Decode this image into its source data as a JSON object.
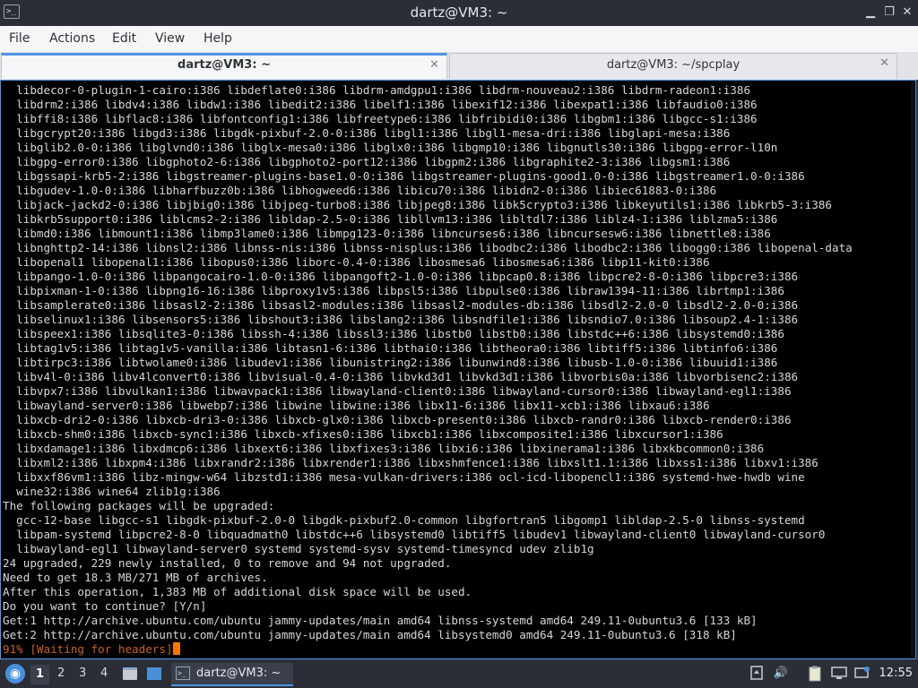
{
  "window": {
    "title": "dartz@VM3: ~",
    "app_icon_glyph": ">_",
    "controls": {
      "minimize": "▁",
      "maximize": "❐",
      "close": "✕"
    }
  },
  "menubar": {
    "items": [
      "File",
      "Actions",
      "Edit",
      "View",
      "Help"
    ]
  },
  "tabs": [
    {
      "label": "dartz@VM3: ~",
      "active": true,
      "close": "✕"
    },
    {
      "label": "dartz@VM3: ~/spcplay",
      "active": false,
      "close": "✕"
    }
  ],
  "terminal": {
    "lines": [
      "  libdecor-0-plugin-1-cairo:i386 libdeflate0:i386 libdrm-amdgpu1:i386 libdrm-nouveau2:i386 libdrm-radeon1:i386",
      "  libdrm2:i386 libdv4:i386 libdw1:i386 libedit2:i386 libelf1:i386 libexif12:i386 libexpat1:i386 libfaudio0:i386",
      "  libffi8:i386 libflac8:i386 libfontconfig1:i386 libfreetype6:i386 libfribidi0:i386 libgbm1:i386 libgcc-s1:i386",
      "  libgcrypt20:i386 libgd3:i386 libgdk-pixbuf-2.0-0:i386 libgl1:i386 libgl1-mesa-dri:i386 libglapi-mesa:i386",
      "  libglib2.0-0:i386 libglvnd0:i386 libglx-mesa0:i386 libglx0:i386 libgmp10:i386 libgnutls30:i386 libgpg-error-l10n",
      "  libgpg-error0:i386 libgphoto2-6:i386 libgphoto2-port12:i386 libgpm2:i386 libgraphite2-3:i386 libgsm1:i386",
      "  libgssapi-krb5-2:i386 libgstreamer-plugins-base1.0-0:i386 libgstreamer-plugins-good1.0-0:i386 libgstreamer1.0-0:i386",
      "  libgudev-1.0-0:i386 libharfbuzz0b:i386 libhogweed6:i386 libicu70:i386 libidn2-0:i386 libiec61883-0:i386",
      "  libjack-jackd2-0:i386 libjbig0:i386 libjpeg-turbo8:i386 libjpeg8:i386 libk5crypto3:i386 libkeyutils1:i386 libkrb5-3:i386",
      "  libkrb5support0:i386 liblcms2-2:i386 libldap-2.5-0:i386 libllvm13:i386 libltdl7:i386 liblz4-1:i386 liblzma5:i386",
      "  libmd0:i386 libmount1:i386 libmp3lame0:i386 libmpg123-0:i386 libncurses6:i386 libncursesw6:i386 libnettle8:i386",
      "  libnghttp2-14:i386 libnsl2:i386 libnss-nis:i386 libnss-nisplus:i386 libodbc2:i386 libodbc2:i386 libogg0:i386 libopenal-data",
      "  libopenal1 libopenal1:i386 libopus0:i386 liborc-0.4-0:i386 libosmesa6 libosmesa6:i386 libp11-kit0:i386",
      "  libpango-1.0-0:i386 libpangocairo-1.0-0:i386 libpangoft2-1.0-0:i386 libpcap0.8:i386 libpcre2-8-0:i386 libpcre3:i386",
      "  libpixman-1-0:i386 libpng16-16:i386 libproxy1v5:i386 libpsl5:i386 libpulse0:i386 libraw1394-11:i386 librtmp1:i386",
      "  libsamplerate0:i386 libsasl2-2:i386 libsasl2-modules:i386 libsasl2-modules-db:i386 libsdl2-2.0-0 libsdl2-2.0-0:i386",
      "  libselinux1:i386 libsensors5:i386 libshout3:i386 libslang2:i386 libsndfile1:i386 libsndio7.0:i386 libsoup2.4-1:i386",
      "  libspeex1:i386 libsqlite3-0:i386 libssh-4:i386 libssl3:i386 libstb0 libstb0:i386 libstdc++6:i386 libsystemd0:i386",
      "  libtag1v5:i386 libtag1v5-vanilla:i386 libtasn1-6:i386 libthai0:i386 libtheora0:i386 libtiff5:i386 libtinfo6:i386",
      "  libtirpc3:i386 libtwolame0:i386 libudev1:i386 libunistring2:i386 libunwind8:i386 libusb-1.0-0:i386 libuuid1:i386",
      "  libv4l-0:i386 libv4lconvert0:i386 libvisual-0.4-0:i386 libvkd3d1 libvkd3d1:i386 libvorbis0a:i386 libvorbisenc2:i386",
      "  libvpx7:i386 libvulkan1:i386 libwavpack1:i386 libwayland-client0:i386 libwayland-cursor0:i386 libwayland-egl1:i386",
      "  libwayland-server0:i386 libwebp7:i386 libwine libwine:i386 libx11-6:i386 libx11-xcb1:i386 libxau6:i386",
      "  libxcb-dri2-0:i386 libxcb-dri3-0:i386 libxcb-glx0:i386 libxcb-present0:i386 libxcb-randr0:i386 libxcb-render0:i386",
      "  libxcb-shm0:i386 libxcb-sync1:i386 libxcb-xfixes0:i386 libxcb1:i386 libxcomposite1:i386 libxcursor1:i386",
      "  libxdamage1:i386 libxdmcp6:i386 libxext6:i386 libxfixes3:i386 libxi6:i386 libxinerama1:i386 libxkbcommon0:i386",
      "  libxml2:i386 libxpm4:i386 libxrandr2:i386 libxrender1:i386 libxshmfence1:i386 libxslt1.1:i386 libxss1:i386 libxv1:i386",
      "  libxxf86vm1:i386 libz-mingw-w64 libzstd1:i386 mesa-vulkan-drivers:i386 ocl-icd-libopencl1:i386 systemd-hwe-hwdb wine",
      "  wine32:i386 wine64 zlib1g:i386",
      "The following packages will be upgraded:",
      "  gcc-12-base libgcc-s1 libgdk-pixbuf-2.0-0 libgdk-pixbuf2.0-common libgfortran5 libgomp1 libldap-2.5-0 libnss-systemd",
      "  libpam-systemd libpcre2-8-0 libquadmath0 libstdc++6 libsystemd0 libtiff5 libudev1 libwayland-client0 libwayland-cursor0",
      "  libwayland-egl1 libwayland-server0 systemd systemd-sysv systemd-timesyncd udev zlib1g",
      "24 upgraded, 229 newly installed, 0 to remove and 94 not upgraded.",
      "Need to get 18.3 MB/271 MB of archives.",
      "After this operation, 1,383 MB of additional disk space will be used.",
      "Do you want to continue? [Y/n]",
      "Get:1 http://archive.ubuntu.com/ubuntu jammy-updates/main amd64 libnss-systemd amd64 249.11-0ubuntu3.6 [133 kB]",
      "Get:2 http://archive.ubuntu.com/ubuntu jammy-updates/main amd64 libsystemd0 amd64 249.11-0ubuntu3.6 [318 kB]"
    ],
    "progress_line": "91% [Waiting for headers]"
  },
  "taskbar": {
    "start_glyph": "◉",
    "workspaces": [
      "1",
      "2",
      "3",
      "4"
    ],
    "task_label": "dartz@VM3: ~",
    "task_icon_glyph": ">_",
    "clock": "12:55",
    "tray": {
      "volume_glyph": "🔊"
    }
  }
}
